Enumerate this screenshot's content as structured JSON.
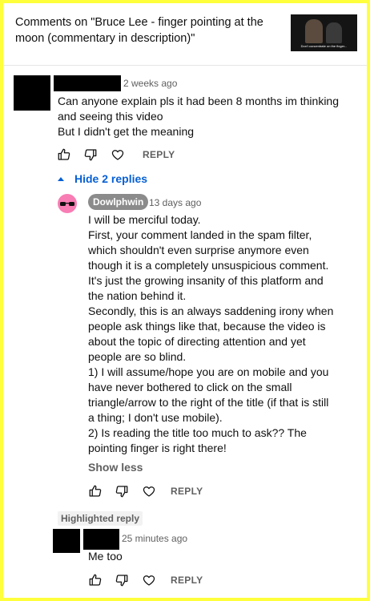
{
  "header": {
    "title": "Comments on \"Bruce Lee - finger pointing at the moon (commentary in description)\"",
    "thumbnail_caption": "Don't concentrate on the finger..."
  },
  "comment": {
    "time": "2 weeks ago",
    "lines": [
      "Can anyone explain pls it had been 8 months im thinking",
      "and seeing this video",
      "But I didn't get the meaning"
    ],
    "reply_label": "REPLY"
  },
  "replies_toggle": "Hide 2 replies",
  "reply1": {
    "author": "Dowlphwin",
    "time": "13 days ago",
    "lines": [
      "I will be merciful today.",
      "First, your comment landed in the spam filter,",
      "which shouldn't even surprise anymore even",
      "though it is a completely unsuspicious comment.",
      "It's just the growing insanity of this platform and",
      "the nation behind it.",
      "Secondly, this is an always saddening irony when",
      "people ask things like that, because the video is",
      "about the topic of directing attention and yet",
      "people are so blind.",
      "1) I will assume/hope you are on mobile and you",
      "have never bothered to click on the small",
      "triangle/arrow to the right of the title (if that is still",
      "a thing; I don't use mobile).",
      "2) Is reading the title too much to ask?? The",
      "pointing finger is right there!"
    ],
    "show_less": "Show less",
    "reply_label": "REPLY"
  },
  "reply2": {
    "highlight_label": "Highlighted reply",
    "time": "25 minutes ago",
    "text": "Me too",
    "reply_label": "REPLY"
  },
  "colors": {
    "page_border": "#ffff3c",
    "link_blue": "#065fd4",
    "secondary_text": "#606060",
    "author_badge": "#8b8b8b",
    "avatar_pink": "#f87db4"
  },
  "icons": [
    "thumbs-up-icon",
    "thumbs-down-icon",
    "heart-icon",
    "caret-up-icon"
  ]
}
